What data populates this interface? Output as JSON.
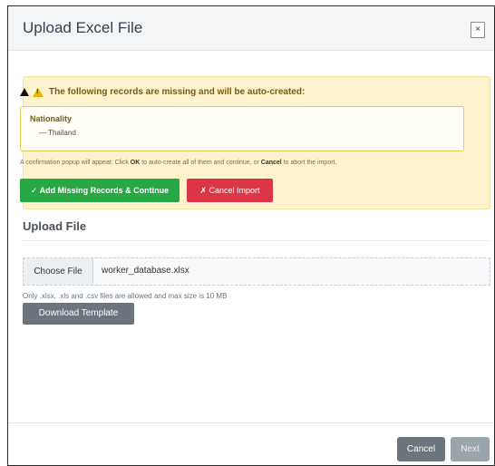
{
  "modal": {
    "title": "Upload Excel File",
    "close_label": "×"
  },
  "warning": {
    "heading": "The following records are missing and will be auto-created:",
    "groups": [
      {
        "name": "Nationality",
        "items": [
          "— Thailand"
        ]
      }
    ],
    "note_prefix": "A confirmation popup will appear. Click ",
    "note_ok": "OK",
    "note_middle": " to auto-create all of them and continue, or ",
    "note_cancel": "Cancel",
    "note_suffix": " to abort the import.",
    "add_button": "✓ Add Missing Records & Continue",
    "cancel_button": "✗ Cancel Import",
    "icons": [
      "warning-icon-black",
      "warning-icon-yellow"
    ]
  },
  "upload": {
    "section_title": "Upload File",
    "choose_label": "Choose File",
    "file_name": "worker_database.xlsx",
    "help_text": "Only .xlsx, .xls and .csv files are allowed and max size is 10 MB",
    "download_button": "Download Template"
  },
  "footer": {
    "cancel_button": "Cancel",
    "next_button": "Next"
  },
  "colors": {
    "success": "#28a745",
    "danger": "#dc3545",
    "secondary": "#6c757d",
    "warning_bg": "#fff3cd"
  }
}
